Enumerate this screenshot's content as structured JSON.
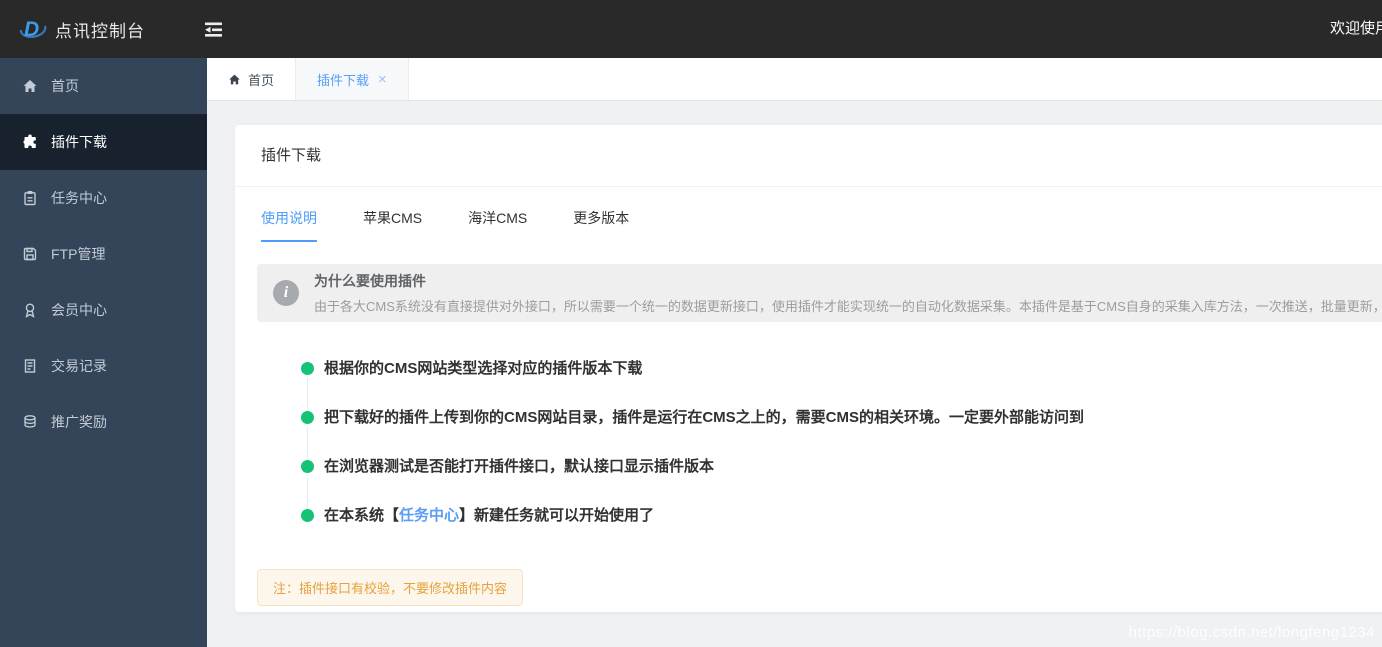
{
  "header": {
    "app_title": "点讯控制台",
    "welcome_text": "欢迎使用"
  },
  "sidebar": {
    "items": [
      {
        "label": "首页",
        "icon": "home-icon",
        "active": false
      },
      {
        "label": "插件下载",
        "icon": "plugin-icon",
        "active": true
      },
      {
        "label": "任务中心",
        "icon": "tasks-icon",
        "active": false
      },
      {
        "label": "FTP管理",
        "icon": "floppy-icon",
        "active": false
      },
      {
        "label": "会员中心",
        "icon": "medal-icon",
        "active": false
      },
      {
        "label": "交易记录",
        "icon": "receipt-icon",
        "active": false
      },
      {
        "label": "推广奖励",
        "icon": "coins-icon",
        "active": false
      }
    ]
  },
  "tabbar": {
    "tabs": [
      {
        "label": "首页",
        "active": false,
        "closable": false
      },
      {
        "label": "插件下载",
        "active": true,
        "closable": true
      }
    ],
    "close_icon": "×"
  },
  "card": {
    "title": "插件下载",
    "tabs": [
      {
        "label": "使用说明",
        "active": true
      },
      {
        "label": "苹果CMS",
        "active": false
      },
      {
        "label": "海洋CMS",
        "active": false
      },
      {
        "label": "更多版本",
        "active": false
      }
    ],
    "info": {
      "title": "为什么要使用插件",
      "body": "由于各大CMS系统没有直接提供对外接口，所以需要一个统一的数据更新接口，使用插件才能实现统一的自动化数据采集。本插件是基于CMS自身的采集入库方法，一次推送，批量更新，减少对系统的请求"
    },
    "steps": [
      {
        "text": "根据你的CMS网站类型选择对应的插件版本下载"
      },
      {
        "text": "把下载好的插件上传到你的CMS网站目录，插件是运行在CMS之上的，需要CMS的相关环境。一定要外部能访问到"
      },
      {
        "text": "在浏览器测试是否能打开插件接口，默认接口显示插件版本"
      },
      {
        "prefix": "在本系统【",
        "link": "任务中心",
        "suffix": "】新建任务就可以开始使用了"
      }
    ],
    "note": "注：插件接口有校验，不要修改插件内容"
  },
  "icons": {
    "info": "i"
  },
  "watermark": "https://blog.csdn.net/longfeng1234",
  "colors": {
    "header_bg": "#292929",
    "sidebar_bg": "#344459",
    "sidebar_active_bg": "#18222f",
    "accent_blue": "#4e9cf8",
    "step_green": "#15c377",
    "warning_text": "#e6a23c",
    "warning_bg": "#fdf6ec"
  }
}
